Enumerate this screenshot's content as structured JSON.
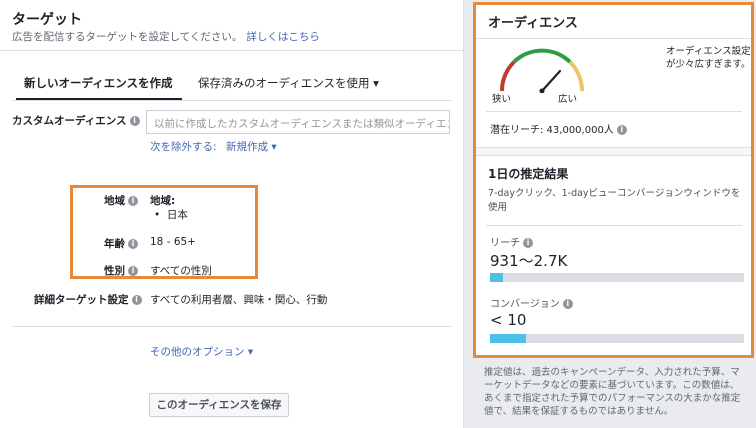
{
  "header": {
    "title": "ターゲット",
    "subtitle": "広告を配信するターゲットを設定してください。",
    "learn_more": "詳しくはこちら"
  },
  "tabs": [
    {
      "label": "新しいオーディエンスを作成",
      "active": true
    },
    {
      "label": "保存済みのオーディエンスを使用 ▾",
      "active": false
    }
  ],
  "custom_audience": {
    "label": "カスタムオーディエンス",
    "placeholder": "以前に作成したカスタムオーディエンスまたは類似オーディエンス",
    "exclude_link": "次を除外する:",
    "new_link": "新規作成 ▾"
  },
  "location": {
    "label": "地域",
    "header": "地域:",
    "items": [
      "日本"
    ]
  },
  "age": {
    "label": "年齢",
    "value": "18 - 65+"
  },
  "gender": {
    "label": "性別",
    "value": "すべての性別"
  },
  "detailed": {
    "label": "詳細ターゲット設定",
    "value": "すべての利用者層、興味・関心、行動"
  },
  "more_options": "その他のオプション ▾",
  "save_button": "このオーディエンスを保存",
  "audience_panel": {
    "title": "オーディエンス",
    "narrow_label": "狭い",
    "wide_label": "広い",
    "description": "オーディエンス設定が少々広すぎます。",
    "potential_reach": "潜在リーチ: 43,000,000人"
  },
  "estimate_panel": {
    "title": "1日の推定結果",
    "description": "7-dayクリック、1-dayビューコンバージョンウィンドウを使用",
    "reach_label": "リーチ",
    "reach_value": "931～2.7K",
    "reach_fraction": 0.05,
    "conv_label": "コンバージョン",
    "conv_value": "< 10",
    "conv_fraction": 0.14
  },
  "disclaimer": "推定値は、過去のキャンペーンデータ、入力された予算、マーケットデータなどの要素に基づいています。この数値は、あくまで指定された予算でのパフォーマンスの大まかな推定値で、結果を保証するものではありません。",
  "colors": {
    "accent": "#4267b2",
    "highlight": "#e8893a",
    "bar_fill": "#4cc0e8",
    "gauge_red": "#c0392b",
    "gauge_green": "#2e9d46",
    "gauge_yellow": "#f0c36b"
  }
}
